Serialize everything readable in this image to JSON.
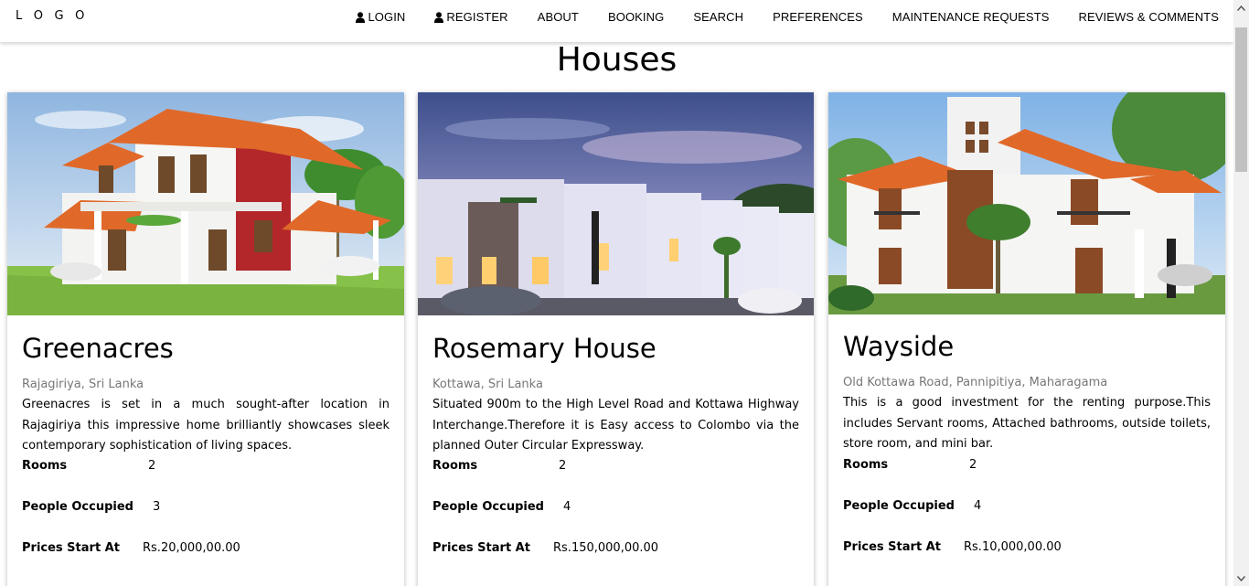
{
  "nav": {
    "logo": "L O G O",
    "items": [
      {
        "label": "LOGIN",
        "icon": "user-icon"
      },
      {
        "label": "REGISTER",
        "icon": "user-icon"
      },
      {
        "label": "ABOUT"
      },
      {
        "label": "BOOKING"
      },
      {
        "label": "SEARCH"
      },
      {
        "label": "PREFERENCES"
      },
      {
        "label": "MAINTENANCE REQUESTS"
      },
      {
        "label": "REVIEWS & COMMENTS"
      }
    ]
  },
  "page": {
    "title": "Houses"
  },
  "houses": [
    {
      "name": "Greenacres",
      "location": "Rajagiriya, Sri Lanka",
      "description": "Greenacres is set in a much sought-after location in Rajagiriya this impressive home brilliantly showcases sleek contemporary sophistication of living spaces.",
      "rooms_label": "Rooms",
      "rooms": "2",
      "people_label": "People Occupied",
      "people": "3",
      "price_label": "Prices Start At",
      "price": "Rs.20,000,00.00"
    },
    {
      "name": "Rosemary House",
      "location": "Kottawa, Sri Lanka",
      "description": "Situated 900m to the High Level Road and Kottawa Highway Interchange.Therefore it is Easy access to Colombo via the planned Outer Circular Expressway.",
      "rooms_label": "Rooms",
      "rooms": "2",
      "people_label": "People Occupied",
      "people": "4",
      "price_label": "Prices Start At",
      "price": "Rs.150,000,00.00"
    },
    {
      "name": "Wayside",
      "location": "Old Kottawa Road, Pannipitiya, Maharagama",
      "description": "This is a good investment for the renting purpose.This includes Servant rooms, Attached bathrooms, outside toilets, store room, and mini bar.",
      "rooms_label": "Rooms",
      "rooms": "2",
      "people_label": "People Occupied",
      "people": "4",
      "price_label": "Prices Start At",
      "price": "Rs.10,000,00.00"
    }
  ],
  "colors": {
    "roof": "#e0692a",
    "wall": "#f4f4f2",
    "accent_red": "#b3262a",
    "lawn": "#8bc34a",
    "sky": "#a9cbe8"
  }
}
